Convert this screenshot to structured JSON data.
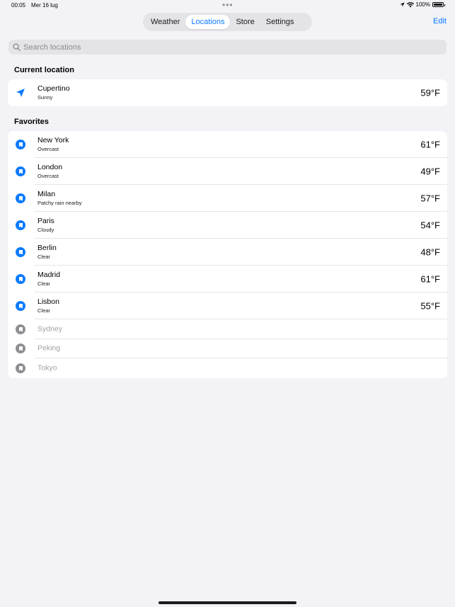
{
  "status_bar": {
    "time": "00:05",
    "date": "Mer 16 lug",
    "dots": "•••",
    "battery": "100%"
  },
  "tabs": [
    {
      "label": "Weather",
      "active": false
    },
    {
      "label": "Locations",
      "active": true
    },
    {
      "label": "Store",
      "active": false
    },
    {
      "label": "Settings",
      "active": false
    }
  ],
  "edit_label": "Edit",
  "search": {
    "placeholder": "Search locations",
    "value": ""
  },
  "current_section": {
    "title": "Current location",
    "item": {
      "name": "Cupertino",
      "condition": "Sunny",
      "temp": "59°F"
    }
  },
  "favorites_section": {
    "title": "Favorites",
    "items": [
      {
        "name": "New York",
        "condition": "Overcast",
        "temp": "61°F"
      },
      {
        "name": "London",
        "condition": "Overcast",
        "temp": "49°F"
      },
      {
        "name": "Milan",
        "condition": "Patchy rain nearby",
        "temp": "57°F"
      },
      {
        "name": "Paris",
        "condition": "Cloudy",
        "temp": "54°F"
      },
      {
        "name": "Berlin",
        "condition": "Clear",
        "temp": "48°F"
      },
      {
        "name": "Madrid",
        "condition": "Clear",
        "temp": "61°F"
      },
      {
        "name": "Lisbon",
        "condition": "Clear",
        "temp": "55°F"
      }
    ],
    "inactive_items": [
      {
        "name": "Sydney"
      },
      {
        "name": "Peking"
      },
      {
        "name": "Tokyo"
      }
    ]
  },
  "colors": {
    "accent": "#0a7aff",
    "background": "#f2f2f7",
    "inactive_icon": "#8e8e93"
  }
}
